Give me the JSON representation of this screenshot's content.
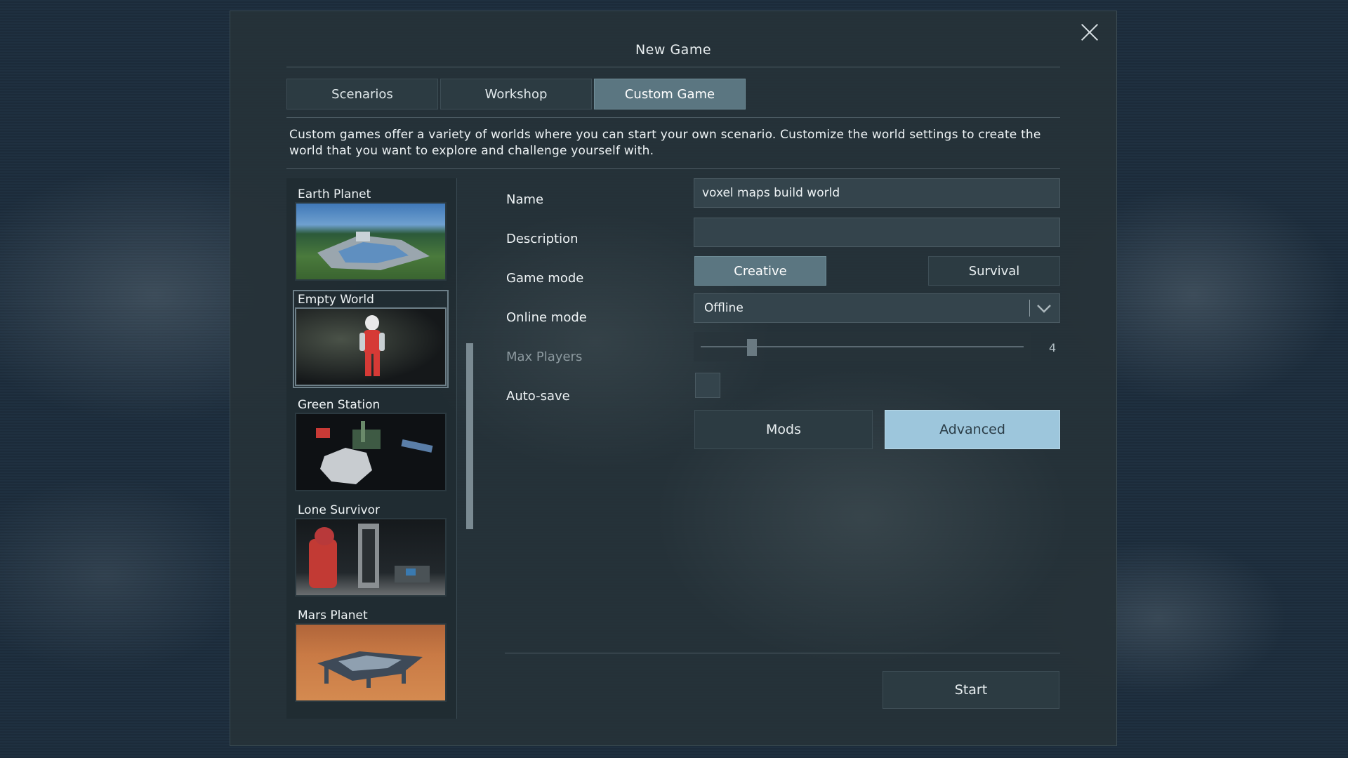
{
  "dialog": {
    "title": "New Game",
    "tabs": [
      {
        "label": "Scenarios",
        "active": false
      },
      {
        "label": "Workshop",
        "active": false
      },
      {
        "label": "Custom Game",
        "active": true
      }
    ],
    "description": "Custom games offer a variety of worlds where you can start your own scenario. Customize the world settings to create the world that you want to explore and challenge yourself with."
  },
  "worlds": [
    {
      "label": "Earth Planet",
      "selected": false
    },
    {
      "label": "Empty World",
      "selected": true
    },
    {
      "label": "Green Station",
      "selected": false
    },
    {
      "label": "Lone Survivor",
      "selected": false
    },
    {
      "label": "Mars Planet",
      "selected": false
    }
  ],
  "form": {
    "name_label": "Name",
    "name_value": "voxel maps build world",
    "description_label": "Description",
    "description_value": "",
    "game_mode_label": "Game mode",
    "game_modes": [
      {
        "label": "Creative",
        "active": true
      },
      {
        "label": "Survival",
        "active": false
      }
    ],
    "online_mode_label": "Online mode",
    "online_mode_value": "Offline",
    "max_players_label": "Max Players",
    "max_players_value": "4",
    "autosave_label": "Auto-save",
    "autosave_checked": false,
    "mods_label": "Mods",
    "advanced_label": "Advanced",
    "start_label": "Start"
  }
}
